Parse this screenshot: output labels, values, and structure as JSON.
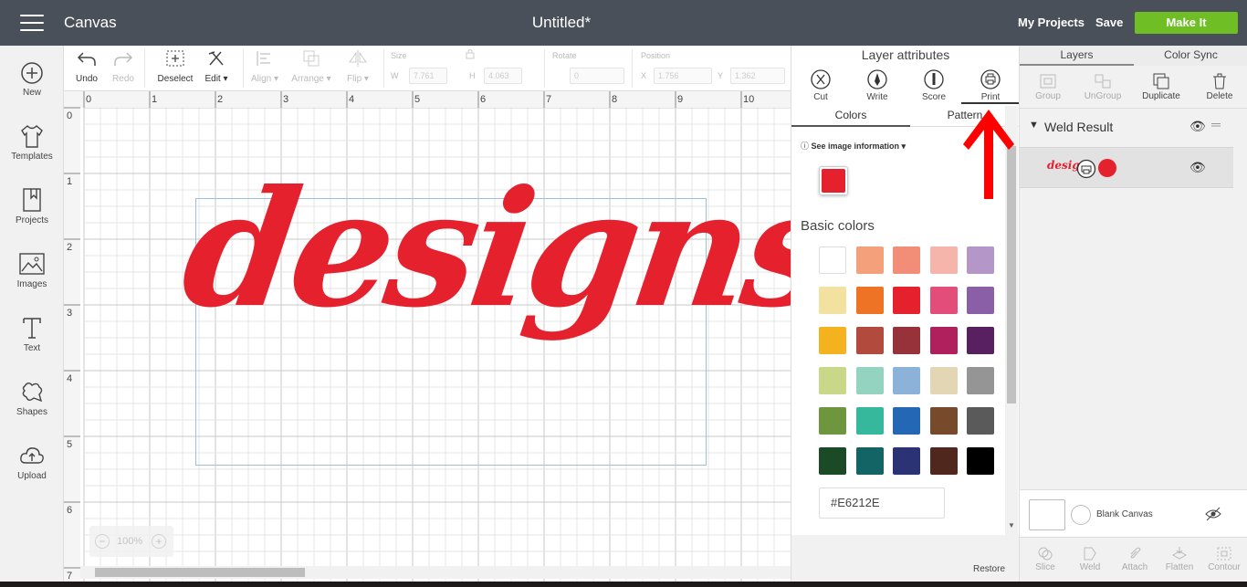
{
  "header": {
    "app_title": "Canvas",
    "doc_title": "Untitled*",
    "my_projects": "My Projects",
    "save": "Save",
    "make_it": "Make It"
  },
  "left_sidebar": {
    "items": [
      {
        "label": "New",
        "icon": "plus-circle-icon"
      },
      {
        "label": "Templates",
        "icon": "tshirt-icon"
      },
      {
        "label": "Projects",
        "icon": "bookmark-icon"
      },
      {
        "label": "Images",
        "icon": "image-icon"
      },
      {
        "label": "Text",
        "icon": "text-T-icon"
      },
      {
        "label": "Shapes",
        "icon": "shapes-icon"
      },
      {
        "label": "Upload",
        "icon": "cloud-upload-icon"
      }
    ]
  },
  "toolbar": {
    "undo": "Undo",
    "redo": "Redo",
    "deselect": "Deselect",
    "edit": "Edit",
    "align": "Align",
    "arrange": "Arrange",
    "flip": "Flip",
    "size_label": "Size",
    "w_label": "W",
    "w_value": "7.761",
    "h_label": "H",
    "h_value": "4.063",
    "rotate_label": "Rotate",
    "rotate_value": "0",
    "position_label": "Position",
    "x_label": "X",
    "x_value": "1.756",
    "y_label": "Y",
    "y_value": "1.362"
  },
  "canvas": {
    "ruler_top": [
      "0",
      "1",
      "2",
      "3",
      "4",
      "5",
      "6",
      "7",
      "8",
      "9",
      "10"
    ],
    "ruler_left": [
      "0",
      "1",
      "2",
      "3",
      "4",
      "5",
      "6",
      "7"
    ],
    "design_text": "designs",
    "zoom": "100%"
  },
  "layer_attributes": {
    "title": "Layer attributes",
    "tools": [
      {
        "label": "Cut",
        "icon": "scissors-icon"
      },
      {
        "label": "Write",
        "icon": "pen-icon"
      },
      {
        "label": "Score",
        "icon": "score-icon"
      },
      {
        "label": "Print",
        "icon": "printer-icon"
      }
    ],
    "tabs": [
      "Colors",
      "Pattern"
    ],
    "see_info": "See image information",
    "basic_colors_title": "Basic colors",
    "hex_value": "#E6212E",
    "restore": "Restore"
  },
  "colors": {
    "current": "#E6212E",
    "grid": [
      [
        "#ffffff",
        "#f3a07b",
        "#f28d77",
        "#f6b5ab",
        "#b596c8"
      ],
      [
        "#f3e1a0",
        "#ee7325",
        "#e6212e",
        "#e24d7a",
        "#8a5fa8"
      ],
      [
        "#f3b21e",
        "#b34a3e",
        "#97313a",
        "#b0205d",
        "#58205f"
      ],
      [
        "#c8d888",
        "#93d3bf",
        "#8db2d9",
        "#e3d6b5",
        "#959595"
      ],
      [
        "#6e963e",
        "#36b89d",
        "#2467b5",
        "#774a2b",
        "#5a5a5a"
      ],
      [
        "#1a4a26",
        "#126465",
        "#2c3375",
        "#50271c",
        "#000000"
      ]
    ]
  },
  "layers_panel": {
    "tabs": [
      "Layers",
      "Color Sync"
    ],
    "actions": [
      "Group",
      "UnGroup",
      "Duplicate",
      "Delete"
    ],
    "group_name": "Weld Result",
    "layer_thumb_text": "designs",
    "blank_canvas": "Blank Canvas",
    "bottom_actions": [
      "Slice",
      "Weld",
      "Attach",
      "Flatten",
      "Contour"
    ]
  }
}
